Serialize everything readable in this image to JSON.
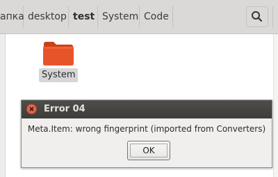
{
  "breadcrumbs": [
    {
      "label": "апка",
      "active": false
    },
    {
      "label": "desktop",
      "active": false
    },
    {
      "label": "test",
      "active": true
    },
    {
      "label": "System",
      "active": false
    },
    {
      "label": "Code",
      "active": false
    }
  ],
  "toolbar": {
    "search_icon": "search-icon"
  },
  "files": [
    {
      "name": "System",
      "icon": "folder-icon",
      "color": "#e8542a"
    }
  ],
  "dialog": {
    "title": "Error 04",
    "message": "Meta.Item: wrong fingerprint (imported from Converters)",
    "ok_label": "OK",
    "close_color": "#e0654a"
  }
}
